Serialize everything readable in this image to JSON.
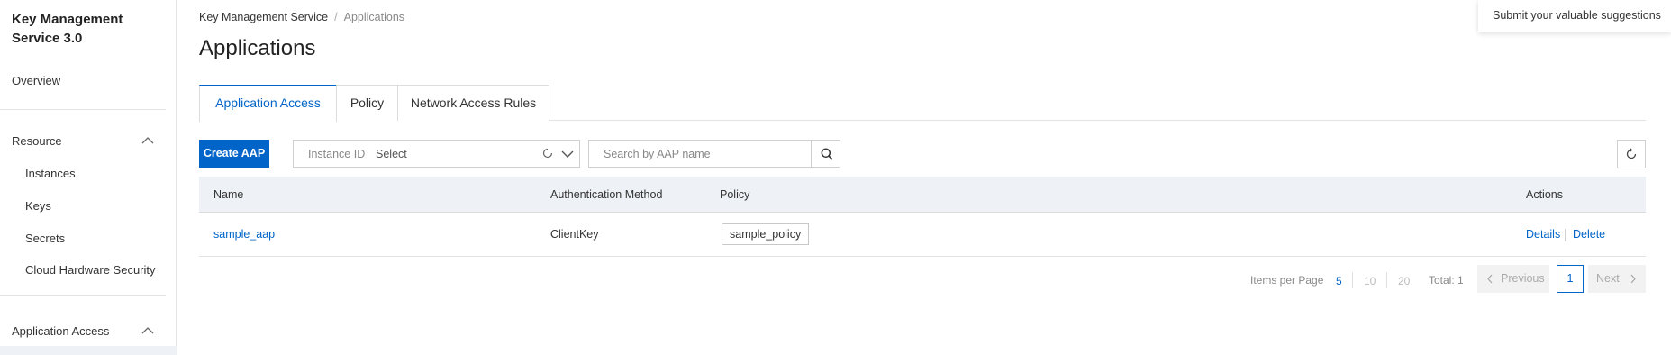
{
  "sidebar": {
    "brand": "Key Management Service 3.0",
    "overview": "Overview",
    "resource_group": "Resource",
    "resource_items": [
      "Instances",
      "Keys",
      "Secrets",
      "Cloud Hardware Security M"
    ],
    "app_access_group": "Application Access"
  },
  "breadcrumb": {
    "root": "Key Management Service",
    "separator": "/",
    "current": "Applications"
  },
  "page_title": "Applications",
  "feedback": "Submit your valuable suggestions",
  "tabs": [
    {
      "label": "Application Access",
      "active": true
    },
    {
      "label": "Policy",
      "active": false
    },
    {
      "label": "Network Access Rules",
      "active": false
    }
  ],
  "toolbar": {
    "create_label": "Create AAP",
    "instance_label": "Instance ID",
    "instance_value": "Select",
    "search_placeholder": "Search by AAP name"
  },
  "table": {
    "columns": [
      "Name",
      "Authentication Method",
      "Policy",
      "Actions"
    ],
    "rows": [
      {
        "name": "sample_aap",
        "auth_method": "ClientKey",
        "policy": "sample_policy",
        "actions": [
          "Details",
          "Delete"
        ]
      }
    ]
  },
  "pagination": {
    "items_per_page_label": "Items per Page",
    "page_sizes": [
      "5",
      "10",
      "20"
    ],
    "selected_page_size": "5",
    "total": "Total: 1",
    "previous": "Previous",
    "current_page": "1",
    "next": "Next"
  },
  "colors": {
    "accent": "#0064c8",
    "header_bg": "#eef1f5"
  }
}
